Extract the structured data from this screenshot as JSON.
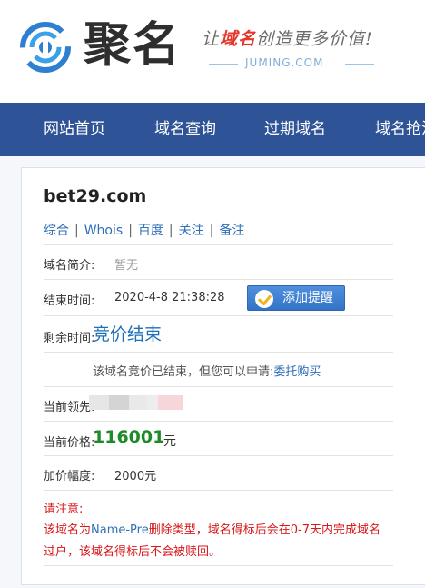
{
  "brand": {
    "name_cn": "聚名",
    "slogan_pre": "让",
    "slogan_hl": "域名",
    "slogan_post": "创造更多价值!",
    "domain": "JUMING.COM"
  },
  "nav": [
    "网站首页",
    "域名查询",
    "过期域名",
    "域名抢注"
  ],
  "domain_name": "bet29.com",
  "links": [
    "综合",
    "Whois",
    "百度",
    "关注",
    "备注"
  ],
  "rows": {
    "intro_label": "域名简介:",
    "intro_value": "暂无",
    "end_label": "结束时间:",
    "end_value": "2020-4-8 21:38:28",
    "remain_label": "剩余时间:",
    "remain_value": "竞价结束",
    "note_text": "该域名竞价已结束，但您可以申请:",
    "note_link": "委托购买",
    "leader_label": "当前领先:",
    "price_label": "当前价格:",
    "price_value": "116001",
    "price_unit": "元",
    "increment_label": "加价幅度:",
    "increment_value": "2000元"
  },
  "remind_button": "添加提醒",
  "warning": {
    "title": "请注意:",
    "line_pre": "该域名为",
    "line_type": "Name-Pre",
    "line_post": "删除类型，域名得标后会在0-7天内完成域名过户，该域名得标后不会被赎回。"
  },
  "colors": {
    "nav_bg": "#2e5396",
    "accent_blue": "#2f6fb8",
    "price_green": "#1e8a2a",
    "warn_red": "#d8181b"
  }
}
